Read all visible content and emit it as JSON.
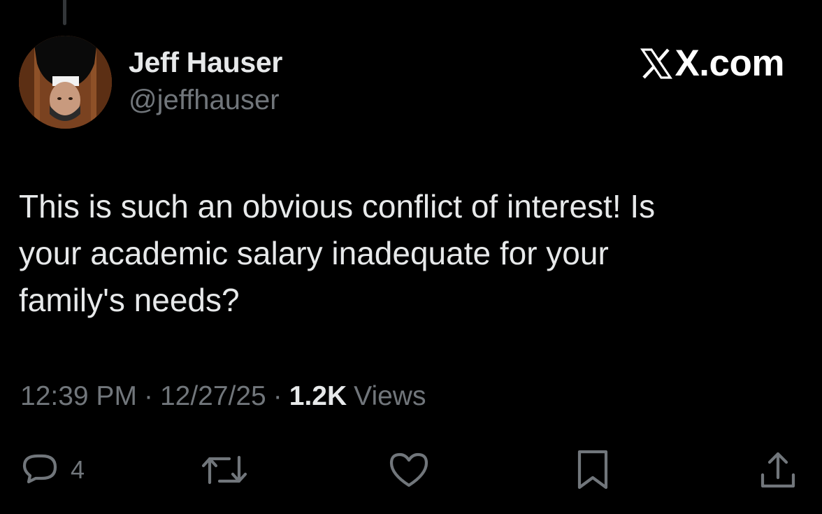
{
  "author": {
    "display_name": "Jeff Hauser",
    "handle": "@jeffhauser"
  },
  "brand": {
    "text": "X.com",
    "icon": "x-logo-icon"
  },
  "tweet": {
    "text": "This is such an obvious conflict of interest! Is\nyour academic salary inadequate for your\nfamily's needs?",
    "time": "12:39 PM",
    "separator": "·",
    "date": "12/27/25",
    "views_count": "1.2K",
    "views_label": "Views"
  },
  "actions": {
    "reply": {
      "icon": "reply-icon",
      "count": "4"
    },
    "repost": {
      "icon": "repost-icon"
    },
    "like": {
      "icon": "heart-icon"
    },
    "bookmark": {
      "icon": "bookmark-icon"
    },
    "share": {
      "icon": "share-icon"
    }
  },
  "colors": {
    "background": "#000000",
    "primary_text": "#e7e9ea",
    "secondary_text": "#71767b"
  }
}
